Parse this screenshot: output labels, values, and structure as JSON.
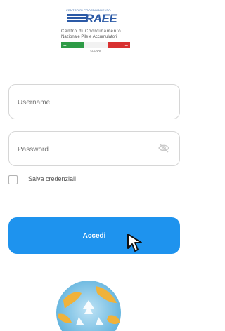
{
  "logo": {
    "top_text": "CENTRO DI COORDINAMENTO",
    "wordmark": "RAEE",
    "line1": "Centro di Coordinamento",
    "line2": "Nazionale Pile e Accumulatori",
    "plus": "+",
    "minus": "−",
    "caption": "CDCNPA"
  },
  "form": {
    "username_placeholder": "Username",
    "password_placeholder": "Password",
    "remember_label": "Salva credenziali",
    "submit_label": "Accedi"
  },
  "colors": {
    "accent": "#1e93ee",
    "brand_blue": "#2c5aa6",
    "flag_green": "#2e9b46",
    "flag_red": "#d83131"
  },
  "icons": {
    "password_toggle": "eye-off-icon",
    "cursor": "mouse-pointer-icon",
    "bottom_graphic": "recycling-globe-icon"
  }
}
